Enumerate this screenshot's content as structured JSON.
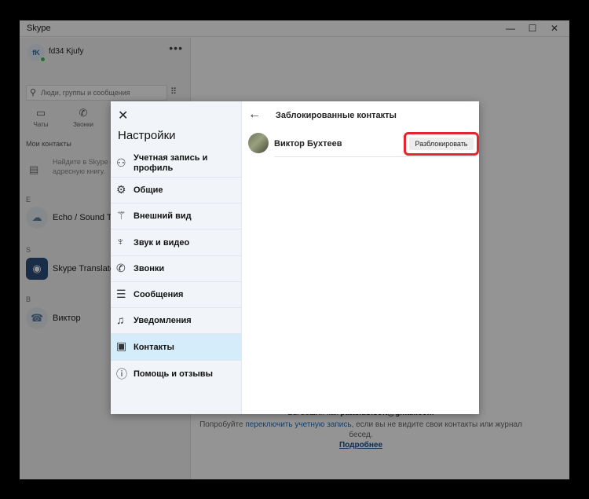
{
  "window": {
    "title": "Skype",
    "minimize": "—",
    "maximize": "☐",
    "close": "✕"
  },
  "profile": {
    "initials": "fK",
    "name": "fd34 Kjufy",
    "more": "•••"
  },
  "search": {
    "placeholder": "Люди, группы и сообщения"
  },
  "nav": {
    "chats": "Чаты",
    "calls": "Звонки"
  },
  "contacts_header": "Мои контакты",
  "hint_text": "Найдите в Skype или синхронизируйте адресную книгу.",
  "letters": {
    "e": "E",
    "s": "S",
    "v": "В"
  },
  "contacts": [
    {
      "name": "Echo / Sound Tes"
    },
    {
      "name": "Skype Translator"
    },
    {
      "name": "Виктор"
    }
  ],
  "background_name": "fd34",
  "footer": {
    "signed_in_prefix": "Вы вошли как ",
    "email": "patts.ubisoft@gmail.com",
    "try_prefix": "Попробуйте ",
    "switch_link": "переключить учетную запись",
    "try_suffix": ", если вы не видите свои контакты или журнал бесед.",
    "more": "Подробнее"
  },
  "settings": {
    "title": "Настройки",
    "items": [
      {
        "label": "Учетная запись и профиль",
        "icon": "person-icon"
      },
      {
        "label": "Общие",
        "icon": "gear-icon"
      },
      {
        "label": "Внешний вид",
        "icon": "magic-wand-icon"
      },
      {
        "label": "Звук и видео",
        "icon": "microphone-icon"
      },
      {
        "label": "Звонки",
        "icon": "phone-icon"
      },
      {
        "label": "Сообщения",
        "icon": "message-icon"
      },
      {
        "label": "Уведомления",
        "icon": "bell-icon"
      },
      {
        "label": "Контакты",
        "icon": "contacts-icon"
      },
      {
        "label": "Помощь и отзывы",
        "icon": "info-icon"
      }
    ],
    "active_item": "Контакты"
  },
  "blocked_pane": {
    "title": "Заблокированные контакты",
    "contact_name": "Виктор Бухтеев",
    "unblock_label": "Разблокировать"
  },
  "colors": {
    "accent": "#1a6fbd",
    "highlight_ring": "#e3262b",
    "active_item": "#d5ecfa"
  }
}
